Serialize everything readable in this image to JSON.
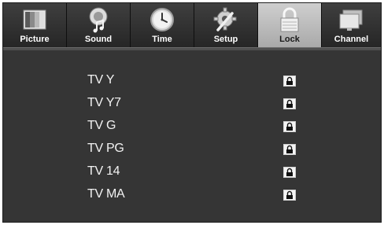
{
  "menu": {
    "tabs": [
      {
        "label": "Picture",
        "icon": "picture-icon"
      },
      {
        "label": "Sound",
        "icon": "sound-icon"
      },
      {
        "label": "Time",
        "icon": "clock-icon"
      },
      {
        "label": "Setup",
        "icon": "wrench-gear-icon"
      },
      {
        "label": "Lock",
        "icon": "lock-icon",
        "active": true
      },
      {
        "label": "Channel",
        "icon": "channel-icon"
      }
    ]
  },
  "ratings": [
    {
      "label": "TV Y",
      "state": "locked"
    },
    {
      "label": "TV Y7",
      "state": "locked"
    },
    {
      "label": "TV G",
      "state": "locked"
    },
    {
      "label": "TV PG",
      "state": "locked"
    },
    {
      "label": "TV 14",
      "state": "locked"
    },
    {
      "label": "TV MA",
      "state": "locked"
    }
  ],
  "colors": {
    "background": "#353535",
    "active_tab": "#bdbdbd",
    "text": "#f2f2f2"
  }
}
